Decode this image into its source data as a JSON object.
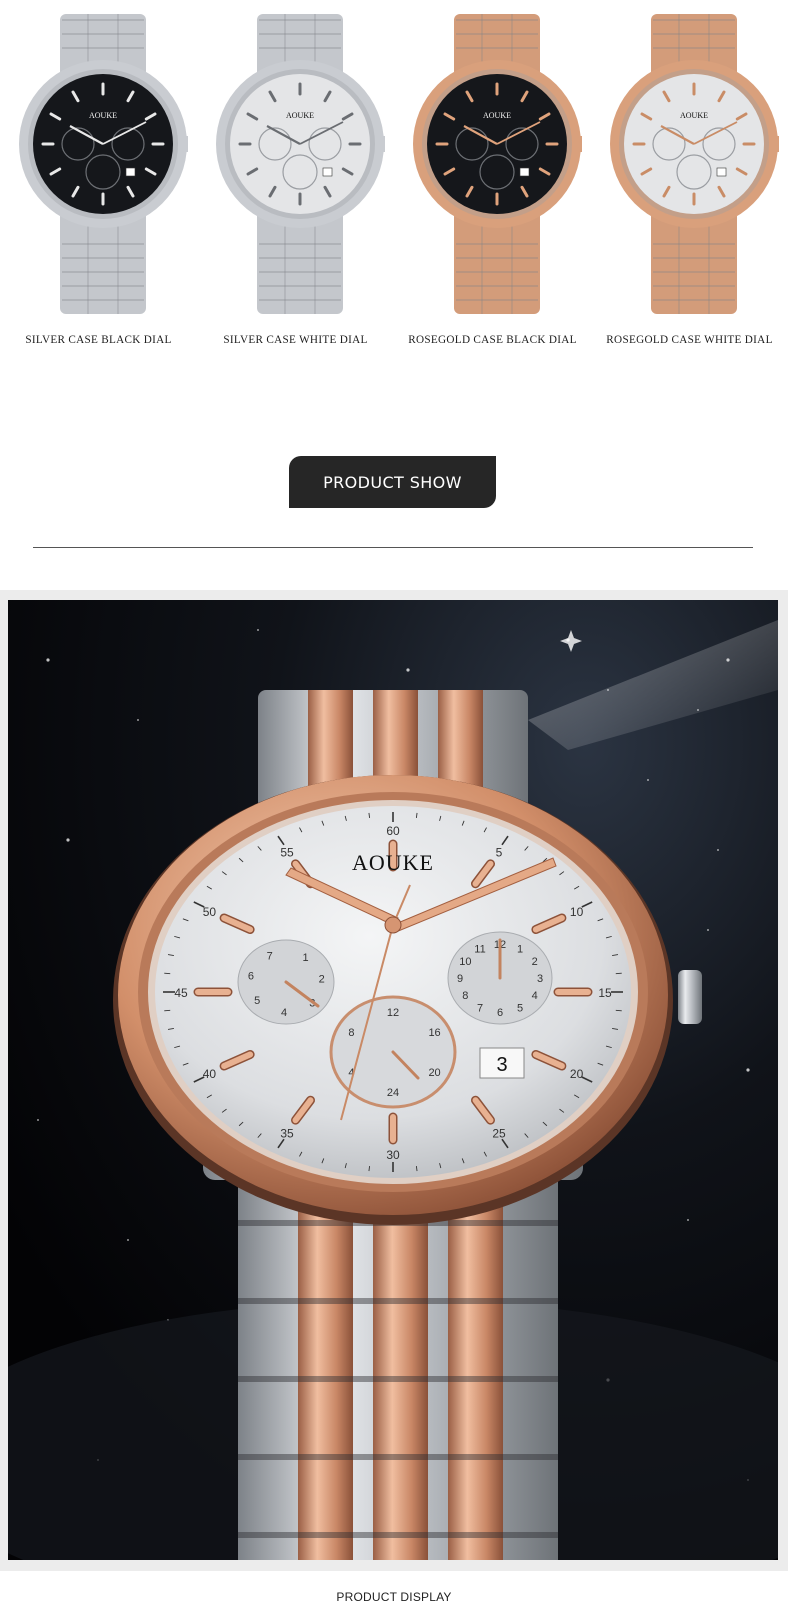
{
  "brand": "AOUKE",
  "variants": [
    {
      "caption": "SILVER CASE BLACK DIAL",
      "case_color": "#c9ccd1",
      "dial_color": "#15171b",
      "marker_color": "#e8e8e8",
      "band_color": "#c4c7cc"
    },
    {
      "caption": "SILVER CASE WHITE DIAL",
      "case_color": "#c9ccd1",
      "dial_color": "#e4e5e7",
      "marker_color": "#6a6d72",
      "band_color": "#c4c7cc"
    },
    {
      "caption": "ROSEGOLD CASE BLACK DIAL",
      "case_color": "#d9a07c",
      "dial_color": "#15171b",
      "marker_color": "#e0a37c",
      "band_color": "#d39c7a"
    },
    {
      "caption": "ROSEGOLD CASE WHITE DIAL",
      "case_color": "#d9a07c",
      "dial_color": "#e4e5e7",
      "marker_color": "#c98c66",
      "band_color": "#d39c7a"
    }
  ],
  "product_show_label": "PRODUCT SHOW",
  "hero": {
    "minute_numbers": [
      "60",
      "5",
      "10",
      "15",
      "20",
      "25",
      "30",
      "35",
      "40",
      "45",
      "50",
      "55"
    ],
    "left_subdial_numbers": [
      "7",
      "6",
      "5",
      "4",
      "3",
      "2",
      "1"
    ],
    "right_subdial_numbers": [
      "12",
      "11",
      "10",
      "9",
      "8",
      "7",
      "6",
      "5",
      "4",
      "3",
      "2",
      "1"
    ],
    "bottom_subdial_numbers": [
      "12",
      "16",
      "20",
      "24",
      "4",
      "8"
    ],
    "date_value": "3"
  },
  "product_display_label": "PRODUCT DISPLAY",
  "colors": {
    "rose_gold": "#d9a07c",
    "steel": "#c9ccd1",
    "button_bg": "#262626"
  }
}
